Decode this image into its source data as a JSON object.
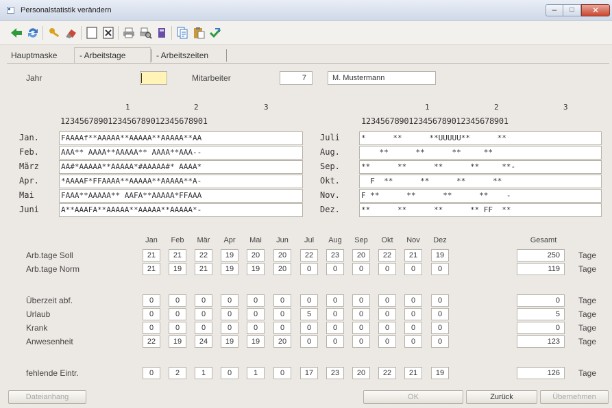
{
  "window": {
    "title": "Personalstatistik verändern",
    "min": "–",
    "max": "□",
    "close": "✕"
  },
  "toolbar": [
    {
      "icon": "arrow-left-icon",
      "color": "#2e9a3e"
    },
    {
      "icon": "refresh-icon",
      "color": "#3c78c8"
    },
    {
      "icon": "key-icon",
      "color": "#d9a321"
    },
    {
      "icon": "eraser-icon",
      "color": "#c84a3a"
    },
    {
      "icon": "blank-page-icon",
      "color": "#555555"
    },
    {
      "icon": "delete-icon",
      "color": "#555555"
    },
    {
      "icon": "printer-icon",
      "color": "#777777"
    },
    {
      "icon": "print-preview-icon",
      "color": "#777777"
    },
    {
      "icon": "export-icon",
      "color": "#6a4fa8"
    },
    {
      "icon": "copy-icon",
      "color": "#3c78c8"
    },
    {
      "icon": "paste-icon",
      "color": "#c89a3a"
    },
    {
      "icon": "check-arrow-icon",
      "color": "#2e9a3e"
    }
  ],
  "tabs": {
    "main": "Hauptmaske",
    "days": "- Arbeitstage",
    "times": "- Arbeitszeiten"
  },
  "header": {
    "year_label": "Jahr",
    "year_value": "",
    "employee_label": "Mitarbeiter",
    "employee_no": "7",
    "employee_name": "M. Mustermann"
  },
  "calendar": {
    "tens_left": [
      "1",
      "2",
      "3"
    ],
    "tens_right": [
      "1",
      "2",
      "3"
    ],
    "digits": "1234567890123456789012345678901",
    "left": [
      {
        "month": "Jan.",
        "code": "FAAAAf**AAAAA**AAAAA**AAAAA**AA"
      },
      {
        "month": "Feb.",
        "code": "AAA** AAAA**AAAAA** AAAA**AAA--"
      },
      {
        "month": "März",
        "code": "AA#*AAAAA**AAAAA*#AAAAA#* AAAA*"
      },
      {
        "month": "Apr.",
        "code": "*AAAAF*FFAAAA**AAAAA**AAAAA**A-"
      },
      {
        "month": "Mai",
        "code": "FAAA**AAAAA** AAFA**AAAAA*FFAAA"
      },
      {
        "month": "Juni",
        "code": "A**AAAFA**AAAAA**AAAAA**AAAAA*-"
      }
    ],
    "right": [
      {
        "month": "Juli",
        "code": "*      **      **UUUUU**      **"
      },
      {
        "month": "Aug.",
        "code": "    **      **      **     **"
      },
      {
        "month": "Sep.",
        "code": "**      **      **      **     **-"
      },
      {
        "month": "Okt.",
        "code": "  F  **      **      **      **"
      },
      {
        "month": "Nov.",
        "code": "F **      **      **      **    -"
      },
      {
        "month": "Dez.",
        "code": "**      **      **      ** FF  **"
      }
    ]
  },
  "stats": {
    "months": [
      "Jan",
      "Feb",
      "Mär",
      "Apr",
      "Mai",
      "Jun",
      "Jul",
      "Aug",
      "Sep",
      "Okt",
      "Nov",
      "Dez"
    ],
    "total_label": "Gesamt",
    "unit": "Tage",
    "rows": [
      {
        "label": "Arb.tage Soll",
        "values": [
          "21",
          "21",
          "22",
          "19",
          "20",
          "20",
          "22",
          "23",
          "20",
          "22",
          "21",
          "19"
        ],
        "total": "250"
      },
      {
        "label": "Arb.tage Norm",
        "values": [
          "21",
          "19",
          "21",
          "19",
          "19",
          "20",
          "0",
          "0",
          "0",
          "0",
          "0",
          "0"
        ],
        "total": "119"
      },
      {
        "label": "Überzeit abf.",
        "values": [
          "0",
          "0",
          "0",
          "0",
          "0",
          "0",
          "0",
          "0",
          "0",
          "0",
          "0",
          "0"
        ],
        "total": "0"
      },
      {
        "label": "Urlaub",
        "values": [
          "0",
          "0",
          "0",
          "0",
          "0",
          "0",
          "5",
          "0",
          "0",
          "0",
          "0",
          "0"
        ],
        "total": "5"
      },
      {
        "label": "Krank",
        "values": [
          "0",
          "0",
          "0",
          "0",
          "0",
          "0",
          "0",
          "0",
          "0",
          "0",
          "0",
          "0"
        ],
        "total": "0"
      },
      {
        "label": "Anwesenheit",
        "values": [
          "22",
          "19",
          "24",
          "19",
          "19",
          "20",
          "0",
          "0",
          "0",
          "0",
          "0",
          "0"
        ],
        "total": "123"
      },
      {
        "label": "fehlende Eintr.",
        "values": [
          "0",
          "2",
          "1",
          "0",
          "1",
          "0",
          "17",
          "23",
          "20",
          "22",
          "21",
          "19"
        ],
        "total": "126"
      }
    ]
  },
  "buttons": {
    "attachment": "Dateianhang",
    "ok": "OK",
    "back": "Zurück",
    "apply": "Übernehmen"
  }
}
